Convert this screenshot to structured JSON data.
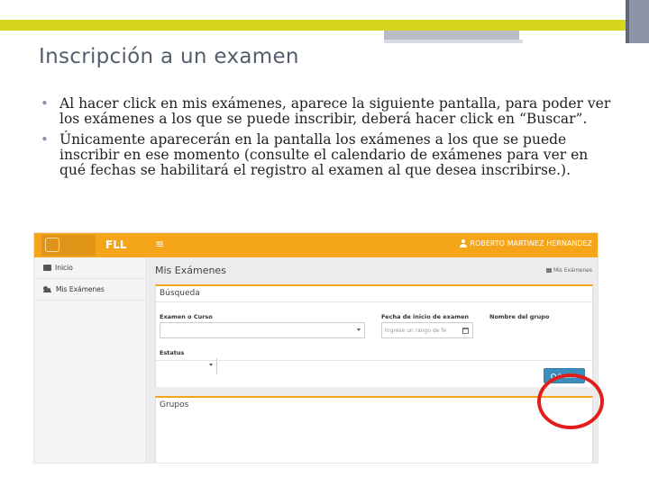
{
  "slide": {
    "title": "Inscripción a un examen",
    "bullets": [
      "Al hacer click en mis exámenes, aparece la siguiente pantalla, para poder ver los exámenes a los que se puede inscribir, deberá hacer click en “Buscar”.",
      "Únicamente aparecerán en la pantalla los exámenes a los que se puede inscribir en ese momento (consulte el calendario de exámenes para ver en qué fechas se habilitará el registro al examen al que desea inscribirse.)."
    ]
  },
  "app": {
    "brand": "FLL",
    "menu_toggle": "≡",
    "user_name": "ROBERTO MARTINEZ HERNANDEZ",
    "sidebar": {
      "items": [
        {
          "label": "Inicio"
        },
        {
          "label": "Mis Exámenes"
        }
      ]
    },
    "page_title": "Mis Exámenes",
    "breadcrumb": "Mis Exámenes",
    "search_panel": {
      "title": "Búsqueda",
      "exam_label": "Examen o Curso",
      "date_label": "Fecha de inicio de examen",
      "date_placeholder": "Ingrese un rango de fe",
      "group_label": "Nombre del grupo",
      "status_label": "Estatus",
      "search_button": "Buscar"
    },
    "groups_panel": {
      "title": "Grupos"
    }
  },
  "colors": {
    "header": "#f5a51a",
    "primary_button": "#3c8dbc",
    "highlight": "#e31c1c"
  }
}
